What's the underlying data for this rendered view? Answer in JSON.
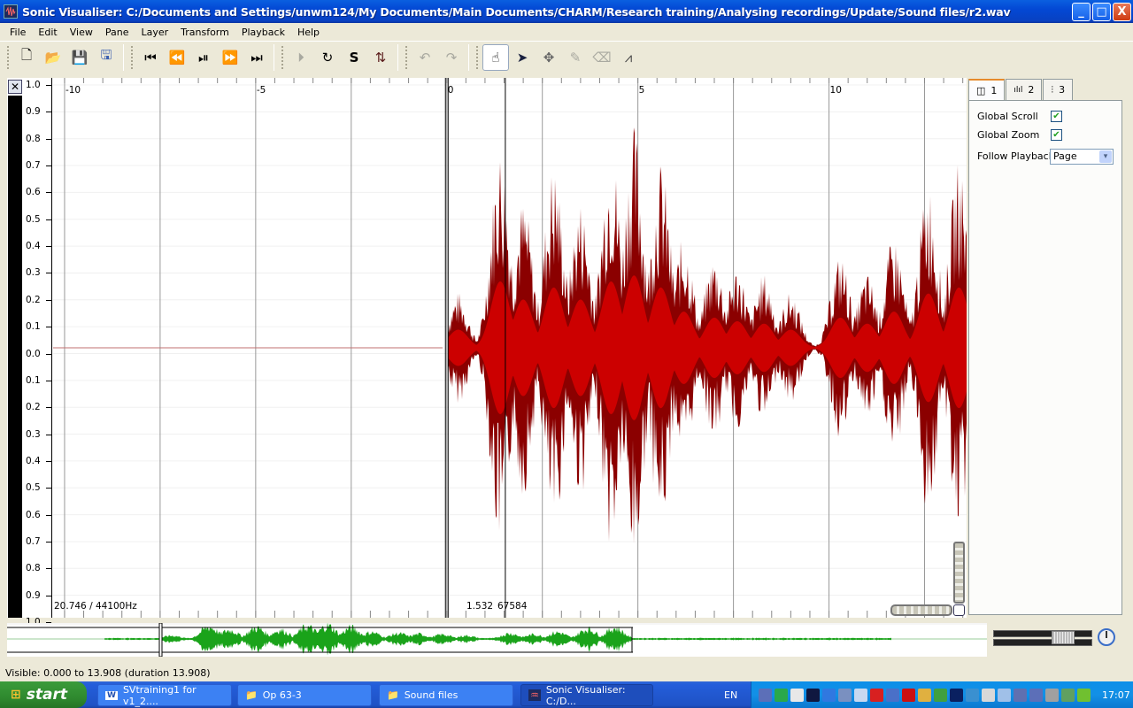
{
  "window": {
    "title": "Sonic Visualiser: C:/Documents and Settings/unwm124/My Documents/Main Documents/CHARM/Research training/Analysing recordings/Update/Sound files/r2.wav",
    "minimize": "_",
    "maximize": "□",
    "close": "X"
  },
  "menu": [
    "File",
    "Edit",
    "View",
    "Pane",
    "Layer",
    "Transform",
    "Playback",
    "Help"
  ],
  "toolbar": {
    "file": [
      {
        "name": "new-file-icon",
        "glyph": "🗋"
      },
      {
        "name": "open-file-icon",
        "glyph": "📂"
      },
      {
        "name": "save-icon",
        "glyph": "💾"
      },
      {
        "name": "save-as-icon",
        "glyph": "🖫"
      }
    ],
    "transport": [
      {
        "name": "rewind-start-icon",
        "glyph": "⏮"
      },
      {
        "name": "rewind-icon",
        "glyph": "⏪"
      },
      {
        "name": "play-pause-icon",
        "glyph": "⏯"
      },
      {
        "name": "fast-forward-icon",
        "glyph": "⏩"
      },
      {
        "name": "ffwd-end-icon",
        "glyph": "⏭"
      }
    ],
    "playmode": [
      {
        "name": "play-selection-icon",
        "glyph": "⏵"
      },
      {
        "name": "loop-icon",
        "glyph": "↻"
      },
      {
        "name": "solo-icon",
        "glyph": "S"
      },
      {
        "name": "align-icon",
        "glyph": "⇅"
      }
    ],
    "edit": [
      {
        "name": "undo-icon",
        "glyph": "↶"
      },
      {
        "name": "redo-icon",
        "glyph": "↷"
      }
    ],
    "tools": [
      {
        "name": "navigate-tool-icon",
        "glyph": "☝",
        "active": true
      },
      {
        "name": "select-tool-icon",
        "glyph": "➤"
      },
      {
        "name": "move-tool-icon",
        "glyph": "✥"
      },
      {
        "name": "draw-tool-icon",
        "glyph": "✎"
      },
      {
        "name": "erase-tool-icon",
        "glyph": "⌫"
      },
      {
        "name": "measure-tool-icon",
        "glyph": "⩘"
      }
    ]
  },
  "pane": {
    "close_icon": "✕",
    "y_axis_labels": [
      "1.0",
      "0.9",
      "0.8",
      "0.7",
      "0.6",
      "0.5",
      "0.4",
      "0.3",
      "0.2",
      "0.1",
      "0.0",
      "0.1",
      "0.2",
      "0.3",
      "0.4",
      "0.5",
      "0.6",
      "0.7",
      "0.8",
      "0.9",
      "1.0"
    ],
    "x_axis_labels": [
      "-10",
      "-5",
      "0",
      "5",
      "10"
    ],
    "x_range_seconds": [
      -10.3,
      13.6
    ],
    "playhead_seconds": 0,
    "cursor_seconds": 1.532,
    "zoom_info": "20.746 / 44100Hz",
    "cursor_time": "1.532",
    "cursor_frame": "67584",
    "waveform_color_outer": "#8b0000",
    "waveform_color_inner": "#cc0000"
  },
  "sidepanel": {
    "tabs": [
      {
        "icon": "◫",
        "label": "1"
      },
      {
        "icon": "ılıl",
        "label": "2"
      },
      {
        "icon": "⫶",
        "label": "3"
      }
    ],
    "global_scroll_label": "Global Scroll",
    "global_scroll_checked": true,
    "global_zoom_label": "Global Zoom",
    "global_zoom_checked": true,
    "follow_playback_label": "Follow Playback",
    "follow_playback_value": "Page",
    "check_glyph": "✔",
    "dropdown_arrow": "▾"
  },
  "overview": {
    "color": "#1aa31a",
    "viewport_seconds": [
      0,
      13.908
    ],
    "duration_seconds": 13.908
  },
  "status": "Visible: 0.000 to 13.908 (duration 13.908)",
  "taskbar": {
    "start": "start",
    "tasks": [
      {
        "label": "SVtraining1 for v1_2....",
        "icon": "W"
      },
      {
        "label": "Op 63-3",
        "icon": "📁"
      },
      {
        "label": "Sound files",
        "icon": "📁"
      },
      {
        "label": "Sonic Visualiser: C:/D...",
        "icon": "♒",
        "active": true
      }
    ],
    "language": "EN",
    "clock": "17:07"
  }
}
